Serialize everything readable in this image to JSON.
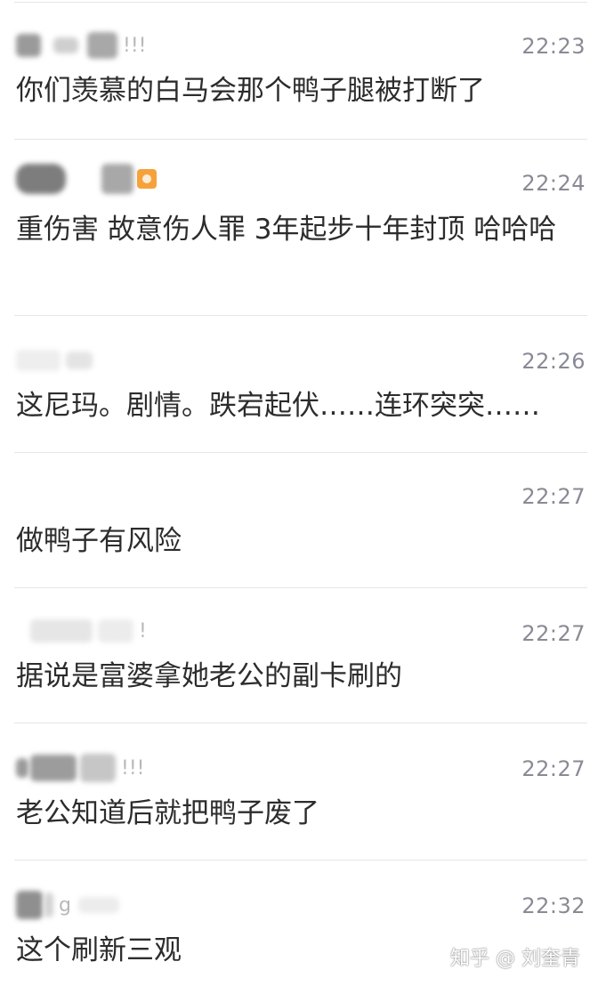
{
  "messages": [
    {
      "name_suffix": "!!!",
      "time": "22:23",
      "text": "你们羡慕的白马会那个鸭子腿被打断了"
    },
    {
      "name_suffix": "",
      "time": "22:24",
      "text": "重伤害 故意伤人罪 3年起步十年封顶  哈哈哈"
    },
    {
      "name_suffix": "",
      "time": "22:26",
      "text": "这尼玛。剧情。跌宕起伏……连环突突……"
    },
    {
      "name_suffix": "",
      "time": "22:27",
      "text": "做鸭子有风险"
    },
    {
      "name_suffix": "!",
      "time": "22:27",
      "text": "据说是富婆拿她老公的副卡刷的"
    },
    {
      "name_suffix": "!!!",
      "time": "22:27",
      "text": "老公知道后就把鸭子废了"
    },
    {
      "name_suffix": "g",
      "time": "22:32",
      "text": "这个刷新三观"
    }
  ],
  "watermark": {
    "text": "知乎 @ 刘奎青"
  }
}
